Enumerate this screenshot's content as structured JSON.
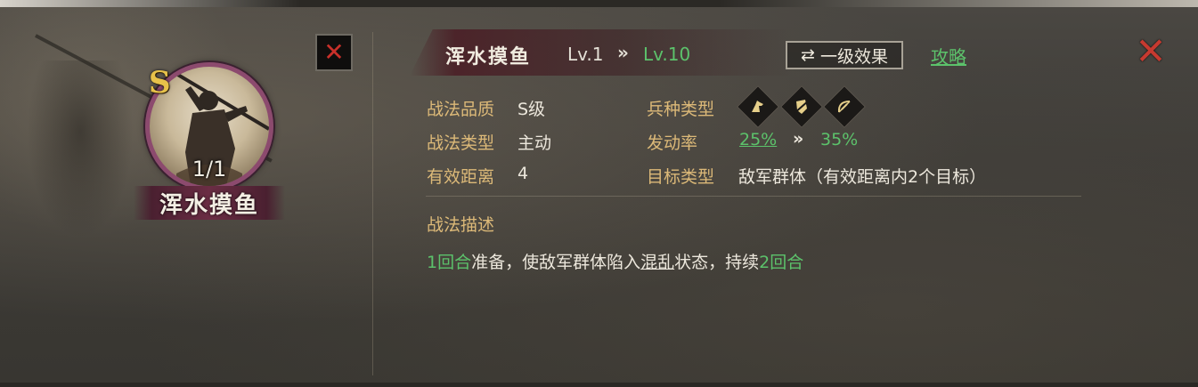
{
  "skill_card": {
    "grade": "S",
    "count": "1/1",
    "name": "浑水摸鱼"
  },
  "header": {
    "skill_name": "浑水摸鱼",
    "lv_current": "Lv.1",
    "lv_arrow": "»",
    "lv_max": "Lv.10",
    "effect_button": "一级效果",
    "effect_icon": "⇄",
    "strategy_link": "攻略",
    "close_glyph": "✕"
  },
  "attributes": {
    "quality_label": "战法品质",
    "quality_value": "S级",
    "type_label": "战法类型",
    "type_value": "主动",
    "range_label": "有效距离",
    "range_value": "4",
    "troop_label": "兵种类型",
    "troop_icons": [
      "cavalry-icon",
      "shield-icon",
      "bow-icon"
    ],
    "rate_label": "发动率",
    "rate_min": "25%",
    "rate_arrow": "»",
    "rate_max": "35%",
    "target_label": "目标类型",
    "target_value": "敌军群体（有效距离内2个目标）"
  },
  "description": {
    "title": "战法描述",
    "seg1": "1回合",
    "seg2": "准备，使敌军群体陷入",
    "seg3": "混乱",
    "seg4": "状态，持续",
    "seg5": "2回合"
  },
  "colors": {
    "gold_label": "#dcb978",
    "green_value": "#5cc26b",
    "close_red": "#c73a30",
    "portrait_ring": "#8c4a6e"
  }
}
